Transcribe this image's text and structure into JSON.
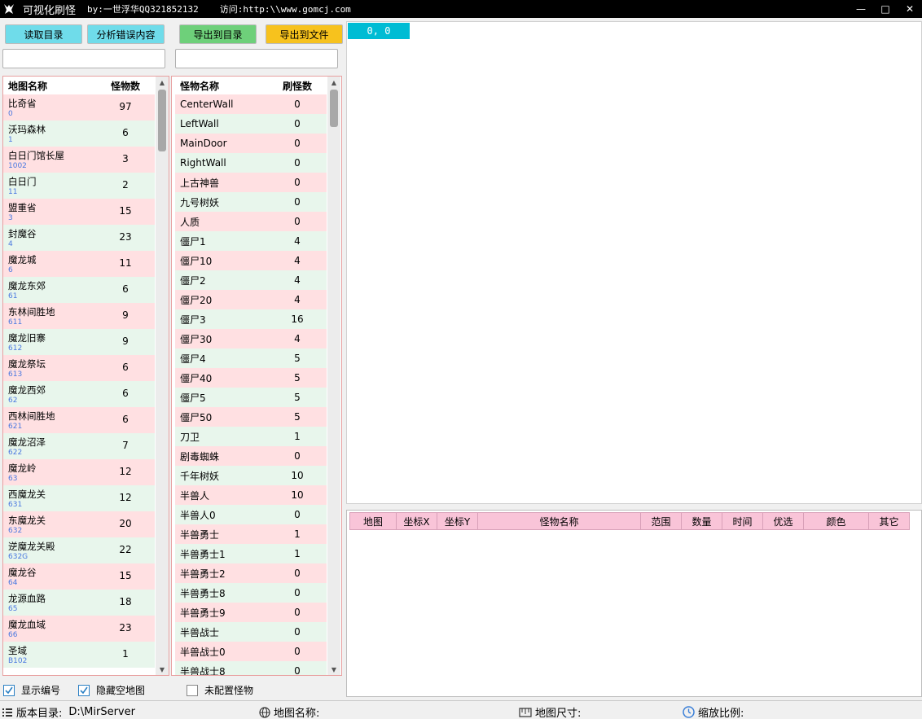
{
  "window": {
    "title": "可视化刷怪",
    "author": "by:一世浮华QQ321852132",
    "visit": "访问:http:\\\\www.gomcj.com",
    "min": "—",
    "max": "□",
    "close": "✕"
  },
  "toolbar": {
    "read_dir": "读取目录",
    "analyze_errors": "分析错误内容",
    "export_dir": "导出到目录",
    "export_file": "导出到文件"
  },
  "search": {
    "map_value": "",
    "monster_value": ""
  },
  "maps": {
    "col_name": "地图名称",
    "col_count": "怪物数",
    "items": [
      {
        "name": "比奇省",
        "id": "0",
        "count": "97"
      },
      {
        "name": "沃玛森林",
        "id": "1",
        "count": "6"
      },
      {
        "name": "白日门馆长屋",
        "id": "1002",
        "count": "3"
      },
      {
        "name": "白日门",
        "id": "11",
        "count": "2"
      },
      {
        "name": "盟重省",
        "id": "3",
        "count": "15"
      },
      {
        "name": "封魔谷",
        "id": "4",
        "count": "23"
      },
      {
        "name": "魔龙城",
        "id": "6",
        "count": "11"
      },
      {
        "name": "魔龙东郊",
        "id": "61",
        "count": "6"
      },
      {
        "name": "东林间胜地",
        "id": "611",
        "count": "9"
      },
      {
        "name": "魔龙旧寨",
        "id": "612",
        "count": "9"
      },
      {
        "name": "魔龙祭坛",
        "id": "613",
        "count": "6"
      },
      {
        "name": "魔龙西郊",
        "id": "62",
        "count": "6"
      },
      {
        "name": "西林间胜地",
        "id": "621",
        "count": "6"
      },
      {
        "name": "魔龙沼泽",
        "id": "622",
        "count": "7"
      },
      {
        "name": "魔龙岭",
        "id": "63",
        "count": "12"
      },
      {
        "name": "西魔龙关",
        "id": "631",
        "count": "12"
      },
      {
        "name": "东魔龙关",
        "id": "632",
        "count": "20"
      },
      {
        "name": "逆魔龙关殿",
        "id": "632G",
        "count": "22"
      },
      {
        "name": "魔龙谷",
        "id": "64",
        "count": "15"
      },
      {
        "name": "龙源血路",
        "id": "65",
        "count": "18"
      },
      {
        "name": "魔龙血域",
        "id": "66",
        "count": "23"
      },
      {
        "name": "圣域",
        "id": "B102",
        "count": "1"
      }
    ]
  },
  "monsters": {
    "col_name": "怪物名称",
    "col_count": "刷怪数",
    "items": [
      {
        "name": "CenterWall",
        "count": "0"
      },
      {
        "name": "LeftWall",
        "count": "0"
      },
      {
        "name": "MainDoor",
        "count": "0"
      },
      {
        "name": "RightWall",
        "count": "0"
      },
      {
        "name": "上古神兽",
        "count": "0"
      },
      {
        "name": "九号树妖",
        "count": "0"
      },
      {
        "name": "人质",
        "count": "0"
      },
      {
        "name": "僵尸1",
        "count": "4"
      },
      {
        "name": "僵尸10",
        "count": "4"
      },
      {
        "name": "僵尸2",
        "count": "4"
      },
      {
        "name": "僵尸20",
        "count": "4"
      },
      {
        "name": "僵尸3",
        "count": "16"
      },
      {
        "name": "僵尸30",
        "count": "4"
      },
      {
        "name": "僵尸4",
        "count": "5"
      },
      {
        "name": "僵尸40",
        "count": "5"
      },
      {
        "name": "僵尸5",
        "count": "5"
      },
      {
        "name": "僵尸50",
        "count": "5"
      },
      {
        "name": "刀卫",
        "count": "1"
      },
      {
        "name": "剧毒蜘蛛",
        "count": "0"
      },
      {
        "name": "千年树妖",
        "count": "10"
      },
      {
        "name": "半兽人",
        "count": "10"
      },
      {
        "name": "半兽人0",
        "count": "0"
      },
      {
        "name": "半兽勇士",
        "count": "1"
      },
      {
        "name": "半兽勇士1",
        "count": "1"
      },
      {
        "name": "半兽勇士2",
        "count": "0"
      },
      {
        "name": "半兽勇士8",
        "count": "0"
      },
      {
        "name": "半兽勇士9",
        "count": "0"
      },
      {
        "name": "半兽战士",
        "count": "0"
      },
      {
        "name": "半兽战士0",
        "count": "0"
      },
      {
        "name": "半兽战士8",
        "count": "0"
      }
    ]
  },
  "canvas": {
    "coord": "0, 0"
  },
  "spawn_table": {
    "headers": [
      "地图",
      "坐标X",
      "坐标Y",
      "怪物名称",
      "范围",
      "数量",
      "时间",
      "优选",
      "颜色",
      "其它"
    ]
  },
  "options": {
    "show_id": "显示编号",
    "hide_empty": "隐藏空地图",
    "unconfigured": "未配置怪物"
  },
  "status": {
    "version_label": "版本目录:",
    "version_value": "D:\\MirServer",
    "map_name_label": "地图名称:",
    "map_size_label": "地图尺寸:",
    "zoom_label": "缩放比例:"
  },
  "colors": {
    "row_pink": "#ffe0e2",
    "row_green": "#e8f6ec",
    "btn_blue": "#6fdcea",
    "btn_green": "#6ed07a",
    "btn_yellow": "#f7c21d",
    "canvas_coord": "#00bcd4",
    "table_header": "#f9c4d8"
  }
}
